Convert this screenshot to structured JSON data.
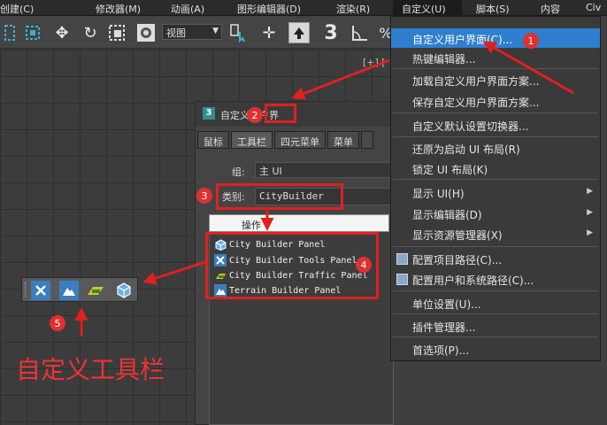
{
  "menubar": {
    "items": [
      "创建(C)",
      "修改器(M)",
      "动画(A)",
      "图形编辑器(D)",
      "渲染(R)",
      "自定义(U)",
      "脚本(S)",
      "内容",
      "Civ"
    ]
  },
  "toolbar": {
    "view_select": "视图"
  },
  "viewport": {
    "label": "[+] ["
  },
  "dialog": {
    "title": "自定义用户界",
    "tabs": [
      "鼠标",
      "工具栏",
      "四元菜单",
      "菜单",
      ""
    ],
    "group_label": "组:",
    "group_value": "主 UI",
    "category_label": "类别:",
    "category_value": "CityBuilder",
    "actions_header": "操作",
    "actions": [
      {
        "label": "City Builder Panel",
        "icon": "cube-icon"
      },
      {
        "label": "City Builder Tools Panel",
        "icon": "tools-icon"
      },
      {
        "label": "City Builder Traffic Panel",
        "icon": "car-icon"
      },
      {
        "label": "Terrain Builder Panel",
        "icon": "mountain-icon"
      }
    ]
  },
  "dropdown": {
    "items": [
      {
        "label": "自定义用户界面(C)...",
        "highlight": true,
        "submenu": false,
        "icon": false
      },
      {
        "label": "热键编辑器...",
        "highlight": false,
        "submenu": false,
        "icon": false
      },
      {
        "label": "加载自定义用户界面方案...",
        "highlight": false,
        "submenu": false,
        "icon": false
      },
      {
        "label": "保存自定义用户界面方案...",
        "highlight": false,
        "submenu": false,
        "icon": false
      },
      {
        "label": "自定义默认设置切换器...",
        "highlight": false,
        "submenu": false,
        "icon": false
      },
      {
        "label": "还原为启动 UI 布局(R)",
        "highlight": false,
        "submenu": false,
        "icon": false
      },
      {
        "label": "锁定 UI 布局(K)",
        "highlight": false,
        "submenu": false,
        "icon": false
      },
      {
        "label": "显示 UI(H)",
        "highlight": false,
        "submenu": true,
        "icon": false
      },
      {
        "label": "显示编辑器(D)",
        "highlight": false,
        "submenu": true,
        "icon": false
      },
      {
        "label": "显示资源管理器(X)",
        "highlight": false,
        "submenu": true,
        "icon": false
      },
      {
        "label": "配置项目路径(C)...",
        "highlight": false,
        "submenu": false,
        "icon": true
      },
      {
        "label": "配置用户和系统路径(C)...",
        "highlight": false,
        "submenu": false,
        "icon": true
      },
      {
        "label": "单位设置(U)...",
        "highlight": false,
        "submenu": false,
        "icon": false
      },
      {
        "label": "插件管理器...",
        "highlight": false,
        "submenu": false,
        "icon": false
      },
      {
        "label": "首选项(P)...",
        "highlight": false,
        "submenu": false,
        "icon": false
      }
    ]
  },
  "custom_toolbar": {
    "buttons": [
      "tools-icon",
      "mountain-icon",
      "car-icon",
      "cube-icon"
    ],
    "caption": "自定义工具栏"
  },
  "badges": [
    "1",
    "2",
    "3",
    "4",
    "5"
  ],
  "colors": {
    "accent": "#2e7fd0",
    "annotation": "#e02020"
  }
}
